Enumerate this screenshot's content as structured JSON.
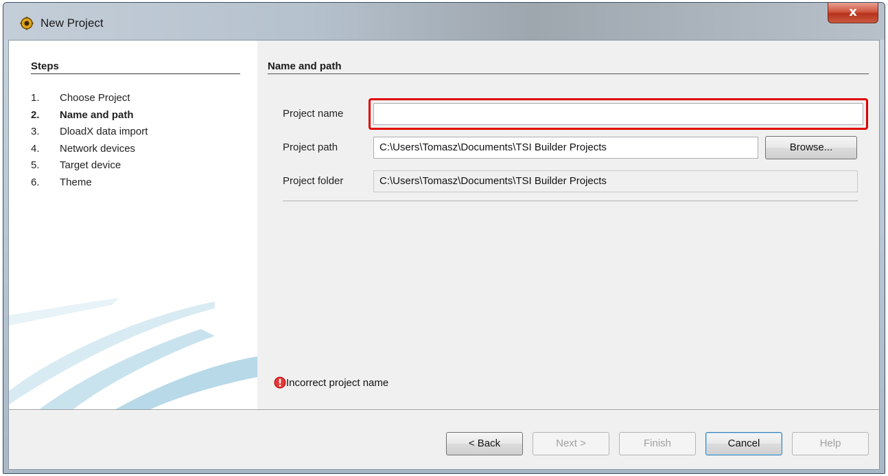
{
  "window": {
    "title": "New Project",
    "close_label": "x"
  },
  "steps_panel": {
    "heading": "Steps",
    "items": [
      {
        "num": "1.",
        "label": "Choose Project",
        "active": false
      },
      {
        "num": "2.",
        "label": "Name and path",
        "active": true
      },
      {
        "num": "3.",
        "label": "DloadX data import",
        "active": false
      },
      {
        "num": "4.",
        "label": "Network devices",
        "active": false
      },
      {
        "num": "5.",
        "label": "Target device",
        "active": false
      },
      {
        "num": "6.",
        "label": "Theme",
        "active": false
      }
    ]
  },
  "main": {
    "section_title": "Name and path",
    "project_name": {
      "label": "Project name",
      "value": ""
    },
    "project_path": {
      "label": "Project path",
      "value": "C:\\Users\\Tomasz\\Documents\\TSI Builder Projects",
      "browse_label": "Browse..."
    },
    "project_folder": {
      "label": "Project folder",
      "value": "C:\\Users\\Tomasz\\Documents\\TSI Builder Projects"
    },
    "error_message": "Incorrect project name"
  },
  "buttons": {
    "back": {
      "label": "< Back",
      "mnemonic": "B"
    },
    "next": {
      "label": "Next >"
    },
    "finish": {
      "label": "Finish",
      "mnemonic": "F"
    },
    "cancel": {
      "label": "Cancel"
    },
    "help": {
      "label": "Help",
      "mnemonic": "H"
    }
  },
  "colors": {
    "highlight": "#e00000",
    "error_icon": "#c0171c"
  }
}
